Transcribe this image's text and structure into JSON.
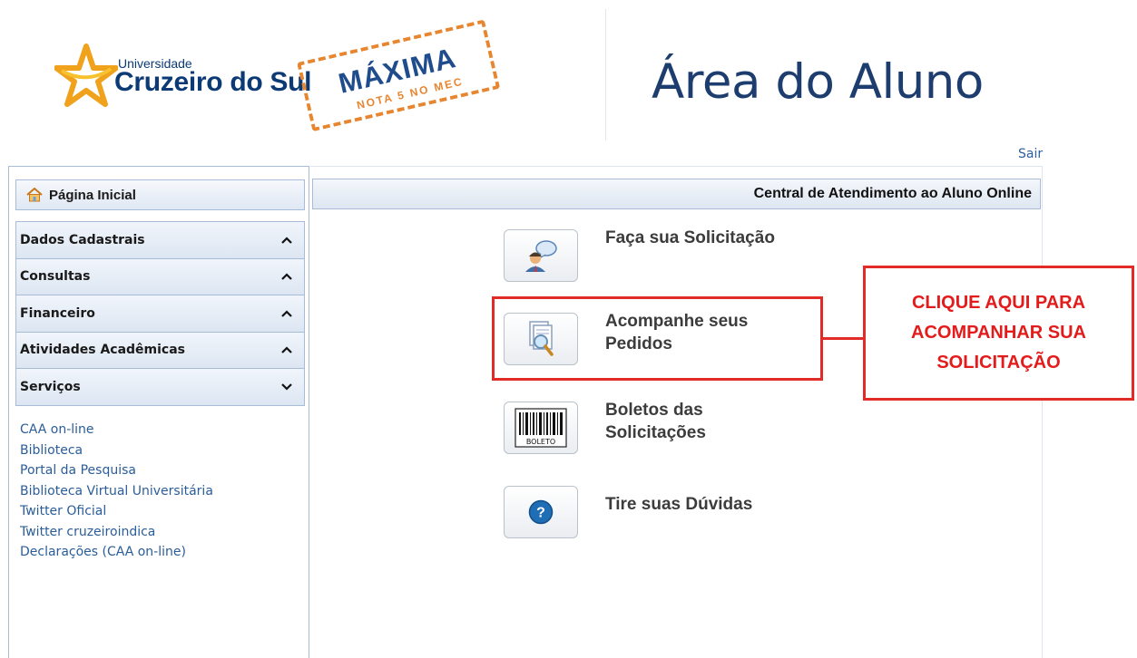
{
  "header": {
    "logo": {
      "small_text": "Universidade",
      "big_text": "Cruzeiro do Sul",
      "stamp_main": "MÁXIMA",
      "stamp_sub": "NOTA 5 NO MEC"
    },
    "page_title": "Área do Aluno",
    "logout_label": "Sair"
  },
  "sidebar": {
    "home_label": "Página Inicial",
    "menu": [
      {
        "label": "Dados Cadastrais",
        "state": "collapsed"
      },
      {
        "label": "Consultas",
        "state": "collapsed"
      },
      {
        "label": "Financeiro",
        "state": "collapsed"
      },
      {
        "label": "Atividades Acadêmicas",
        "state": "collapsed"
      },
      {
        "label": "Serviços",
        "state": "expanded"
      }
    ],
    "services_links": [
      "CAA on-line",
      "Biblioteca",
      "Portal da Pesquisa",
      "Biblioteca Virtual Universitária",
      "Twitter Oficial",
      "Twitter cruzeiroindica",
      "Declarações (CAA on-line)"
    ]
  },
  "main": {
    "title": "Central de Atendimento ao Aluno Online",
    "options": [
      {
        "label": "Faça sua Solicitação",
        "icon": "support-agent-icon"
      },
      {
        "label": "Acompanhe seus Pedidos",
        "icon": "document-search-icon"
      },
      {
        "label": "Boletos das Solicitações",
        "icon": "barcode-icon",
        "icon_text": "BOLETO"
      },
      {
        "label": "Tire suas Dúvidas",
        "icon": "help-icon",
        "icon_text": "?"
      }
    ]
  },
  "annotation": {
    "callout_text": "CLIQUE AQUI PARA ACOMPANHAR SUA SOLICITAÇÃO",
    "color": "#e02b26"
  },
  "colors": {
    "brand_blue": "#1e3d6f",
    "link_blue": "#2a5d99",
    "stamp_orange": "#e8852f",
    "panel_border": "#a8bcd8"
  }
}
